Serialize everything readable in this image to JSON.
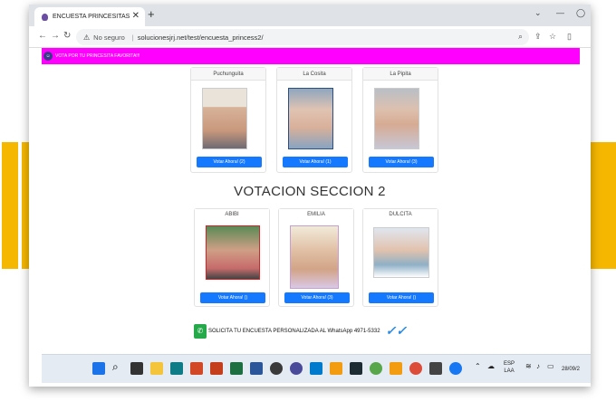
{
  "browser": {
    "tab_title": "ENCUESTA PRINCESITAS",
    "tab_close": "✕",
    "new_tab": "+",
    "address": {
      "security_label": "No seguro",
      "url": "solucionesjrj.net/test/encuesta_princess2/"
    }
  },
  "page": {
    "banner_text": "VOTA POR TU PRINCESITA FAVORITA!!!",
    "section1": {
      "cards": [
        {
          "name": "Puchunguita",
          "vote_label": "Votar Ahora! (2)"
        },
        {
          "name": "La Cosita",
          "vote_label": "Votar Ahora! (1)"
        },
        {
          "name": "La Pipita",
          "vote_label": "Votar Ahora! (3)"
        }
      ]
    },
    "section2": {
      "title": "VOTACION SECCION 2",
      "cards": [
        {
          "name": "ABIBI",
          "vote_label": "Votar Ahora! ()"
        },
        {
          "name": "EMILIA",
          "vote_label": "Votar Ahora! (3)"
        },
        {
          "name": "DULCITA",
          "vote_label": "Votar Ahora! ()"
        }
      ]
    },
    "whatsapp_text": "SOLICITA TU ENCUESTA PERSONALIZADA AL WhatsApp 4971-5332"
  },
  "taskbar": {
    "lang_top": "ESP",
    "lang_bottom": "LAA",
    "date": "28/09/2"
  },
  "colors": {
    "banner": "#ff00ff",
    "vote_button": "#1479ff",
    "accent_yellow": "#f5b700"
  }
}
